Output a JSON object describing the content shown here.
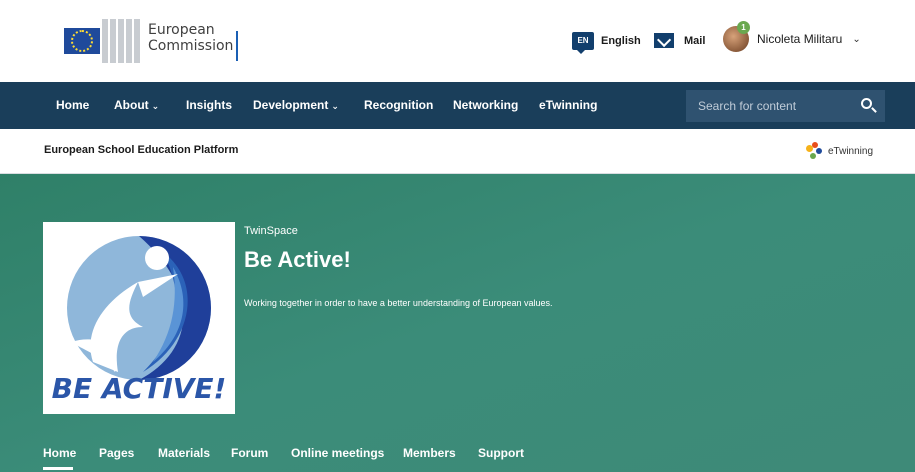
{
  "header": {
    "brand": {
      "line1": "European",
      "line2": "Commission"
    },
    "language": {
      "code": "EN",
      "label": "English"
    },
    "mail": {
      "label": "Mail"
    },
    "user": {
      "name": "Nicoleta Militaru",
      "notifications": "1"
    }
  },
  "nav": {
    "items": [
      {
        "label": "Home",
        "has_dropdown": false
      },
      {
        "label": "About",
        "has_dropdown": true
      },
      {
        "label": "Insights",
        "has_dropdown": false
      },
      {
        "label": "Development",
        "has_dropdown": true
      },
      {
        "label": "Recognition",
        "has_dropdown": false
      },
      {
        "label": "Networking",
        "has_dropdown": false
      },
      {
        "label": "eTwinning",
        "has_dropdown": false
      }
    ],
    "search": {
      "placeholder": "Search for content"
    }
  },
  "platform": {
    "title": "European School Education Platform",
    "etwinning_label": "eTwinning"
  },
  "twinspace": {
    "kicker": "TwinSpace",
    "title": "Be Active!",
    "description": "Working together in order to have a better understanding of European values.",
    "logo_text": "BE ACTIVE!",
    "tabs": [
      {
        "label": "Home",
        "active": true
      },
      {
        "label": "Pages",
        "active": false
      },
      {
        "label": "Materials",
        "active": false
      },
      {
        "label": "Forum",
        "active": false
      },
      {
        "label": "Online meetings",
        "active": false
      },
      {
        "label": "Members",
        "active": false
      },
      {
        "label": "Support",
        "active": false
      }
    ]
  },
  "colors": {
    "nav_bg": "#1a3e5a",
    "hero_bg": "#3b8c79",
    "accent_dark_blue": "#123f6d",
    "logo_blue": "#1f4a9b"
  }
}
